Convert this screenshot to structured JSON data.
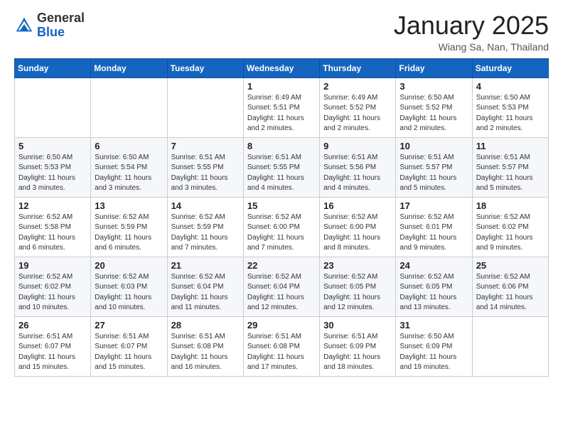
{
  "header": {
    "logo_general": "General",
    "logo_blue": "Blue",
    "month_title": "January 2025",
    "location": "Wiang Sa, Nan, Thailand"
  },
  "weekdays": [
    "Sunday",
    "Monday",
    "Tuesday",
    "Wednesday",
    "Thursday",
    "Friday",
    "Saturday"
  ],
  "weeks": [
    [
      {
        "day": "",
        "info": ""
      },
      {
        "day": "",
        "info": ""
      },
      {
        "day": "",
        "info": ""
      },
      {
        "day": "1",
        "info": "Sunrise: 6:49 AM\nSunset: 5:51 PM\nDaylight: 11 hours\nand 2 minutes."
      },
      {
        "day": "2",
        "info": "Sunrise: 6:49 AM\nSunset: 5:52 PM\nDaylight: 11 hours\nand 2 minutes."
      },
      {
        "day": "3",
        "info": "Sunrise: 6:50 AM\nSunset: 5:52 PM\nDaylight: 11 hours\nand 2 minutes."
      },
      {
        "day": "4",
        "info": "Sunrise: 6:50 AM\nSunset: 5:53 PM\nDaylight: 11 hours\nand 2 minutes."
      }
    ],
    [
      {
        "day": "5",
        "info": "Sunrise: 6:50 AM\nSunset: 5:53 PM\nDaylight: 11 hours\nand 3 minutes."
      },
      {
        "day": "6",
        "info": "Sunrise: 6:50 AM\nSunset: 5:54 PM\nDaylight: 11 hours\nand 3 minutes."
      },
      {
        "day": "7",
        "info": "Sunrise: 6:51 AM\nSunset: 5:55 PM\nDaylight: 11 hours\nand 3 minutes."
      },
      {
        "day": "8",
        "info": "Sunrise: 6:51 AM\nSunset: 5:55 PM\nDaylight: 11 hours\nand 4 minutes."
      },
      {
        "day": "9",
        "info": "Sunrise: 6:51 AM\nSunset: 5:56 PM\nDaylight: 11 hours\nand 4 minutes."
      },
      {
        "day": "10",
        "info": "Sunrise: 6:51 AM\nSunset: 5:57 PM\nDaylight: 11 hours\nand 5 minutes."
      },
      {
        "day": "11",
        "info": "Sunrise: 6:51 AM\nSunset: 5:57 PM\nDaylight: 11 hours\nand 5 minutes."
      }
    ],
    [
      {
        "day": "12",
        "info": "Sunrise: 6:52 AM\nSunset: 5:58 PM\nDaylight: 11 hours\nand 6 minutes."
      },
      {
        "day": "13",
        "info": "Sunrise: 6:52 AM\nSunset: 5:59 PM\nDaylight: 11 hours\nand 6 minutes."
      },
      {
        "day": "14",
        "info": "Sunrise: 6:52 AM\nSunset: 5:59 PM\nDaylight: 11 hours\nand 7 minutes."
      },
      {
        "day": "15",
        "info": "Sunrise: 6:52 AM\nSunset: 6:00 PM\nDaylight: 11 hours\nand 7 minutes."
      },
      {
        "day": "16",
        "info": "Sunrise: 6:52 AM\nSunset: 6:00 PM\nDaylight: 11 hours\nand 8 minutes."
      },
      {
        "day": "17",
        "info": "Sunrise: 6:52 AM\nSunset: 6:01 PM\nDaylight: 11 hours\nand 9 minutes."
      },
      {
        "day": "18",
        "info": "Sunrise: 6:52 AM\nSunset: 6:02 PM\nDaylight: 11 hours\nand 9 minutes."
      }
    ],
    [
      {
        "day": "19",
        "info": "Sunrise: 6:52 AM\nSunset: 6:02 PM\nDaylight: 11 hours\nand 10 minutes."
      },
      {
        "day": "20",
        "info": "Sunrise: 6:52 AM\nSunset: 6:03 PM\nDaylight: 11 hours\nand 10 minutes."
      },
      {
        "day": "21",
        "info": "Sunrise: 6:52 AM\nSunset: 6:04 PM\nDaylight: 11 hours\nand 11 minutes."
      },
      {
        "day": "22",
        "info": "Sunrise: 6:52 AM\nSunset: 6:04 PM\nDaylight: 11 hours\nand 12 minutes."
      },
      {
        "day": "23",
        "info": "Sunrise: 6:52 AM\nSunset: 6:05 PM\nDaylight: 11 hours\nand 12 minutes."
      },
      {
        "day": "24",
        "info": "Sunrise: 6:52 AM\nSunset: 6:05 PM\nDaylight: 11 hours\nand 13 minutes."
      },
      {
        "day": "25",
        "info": "Sunrise: 6:52 AM\nSunset: 6:06 PM\nDaylight: 11 hours\nand 14 minutes."
      }
    ],
    [
      {
        "day": "26",
        "info": "Sunrise: 6:51 AM\nSunset: 6:07 PM\nDaylight: 11 hours\nand 15 minutes."
      },
      {
        "day": "27",
        "info": "Sunrise: 6:51 AM\nSunset: 6:07 PM\nDaylight: 11 hours\nand 15 minutes."
      },
      {
        "day": "28",
        "info": "Sunrise: 6:51 AM\nSunset: 6:08 PM\nDaylight: 11 hours\nand 16 minutes."
      },
      {
        "day": "29",
        "info": "Sunrise: 6:51 AM\nSunset: 6:08 PM\nDaylight: 11 hours\nand 17 minutes."
      },
      {
        "day": "30",
        "info": "Sunrise: 6:51 AM\nSunset: 6:09 PM\nDaylight: 11 hours\nand 18 minutes."
      },
      {
        "day": "31",
        "info": "Sunrise: 6:50 AM\nSunset: 6:09 PM\nDaylight: 11 hours\nand 19 minutes."
      },
      {
        "day": "",
        "info": ""
      }
    ]
  ]
}
